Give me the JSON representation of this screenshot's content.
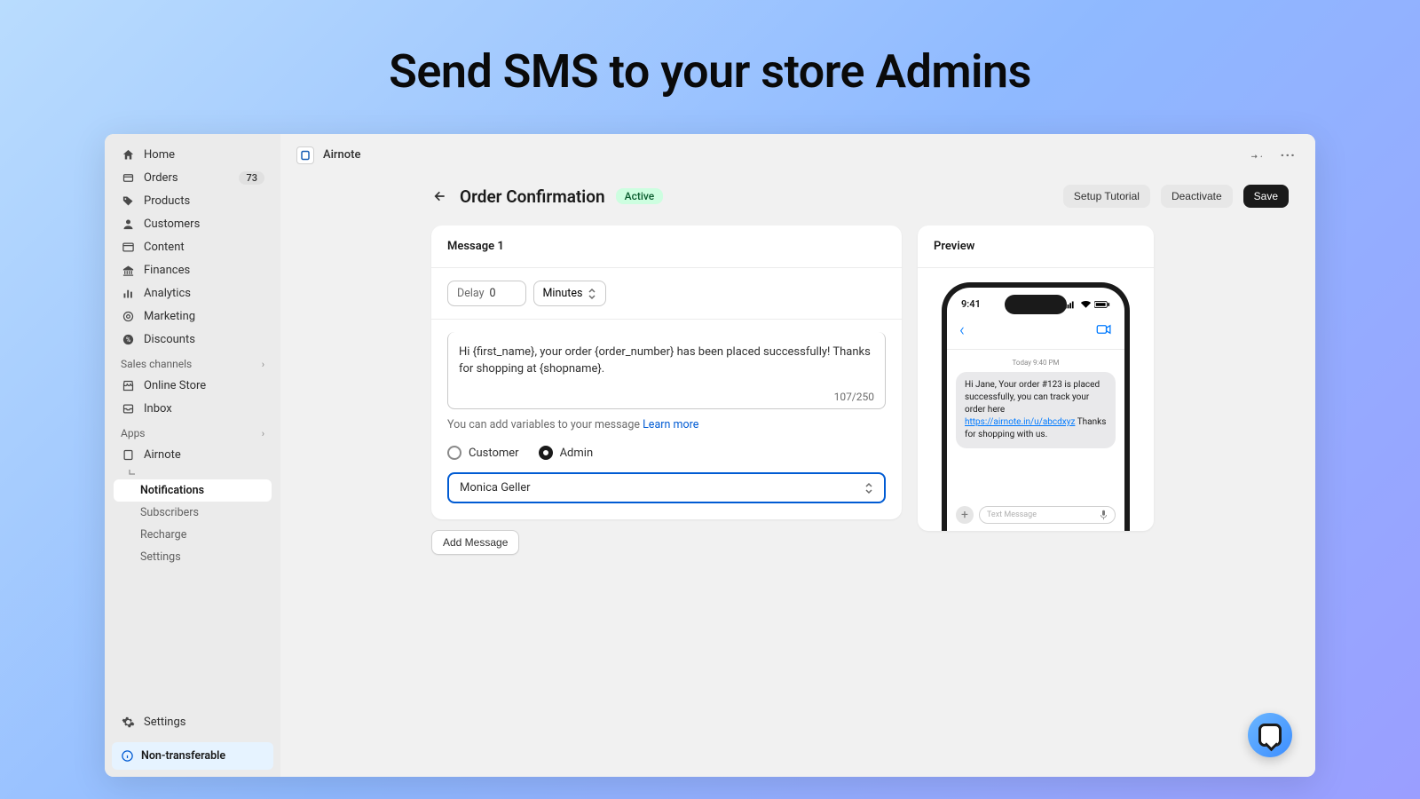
{
  "hero": {
    "title": "Send SMS to your store Admins"
  },
  "sidebar": {
    "nav": [
      {
        "label": "Home",
        "icon": "home"
      },
      {
        "label": "Orders",
        "icon": "orders",
        "badge": "73"
      },
      {
        "label": "Products",
        "icon": "tag"
      },
      {
        "label": "Customers",
        "icon": "user"
      },
      {
        "label": "Content",
        "icon": "content"
      },
      {
        "label": "Finances",
        "icon": "bank"
      },
      {
        "label": "Analytics",
        "icon": "bars"
      },
      {
        "label": "Marketing",
        "icon": "target"
      },
      {
        "label": "Discounts",
        "icon": "discount"
      }
    ],
    "sections": {
      "sales_channels": {
        "title": "Sales channels",
        "items": [
          {
            "label": "Online Store",
            "icon": "store"
          },
          {
            "label": "Inbox",
            "icon": "inbox"
          }
        ]
      },
      "apps": {
        "title": "Apps",
        "items": [
          {
            "label": "Airnote",
            "icon": "airnote",
            "children": [
              {
                "label": "Notifications",
                "active": true
              },
              {
                "label": "Subscribers"
              },
              {
                "label": "Recharge"
              },
              {
                "label": "Settings"
              }
            ]
          }
        ]
      }
    },
    "settings_label": "Settings",
    "nt_label": "Non-transferable"
  },
  "topbar": {
    "app_name": "Airnote"
  },
  "page": {
    "title": "Order Confirmation",
    "status": "Active",
    "buttons": {
      "tutorial": "Setup Tutorial",
      "deactivate": "Deactivate",
      "save": "Save"
    }
  },
  "message": {
    "header": "Message 1",
    "delay": {
      "label": "Delay",
      "value": "0",
      "unit": "Minutes"
    },
    "body": "Hi {first_name}, your order {order_number} has been placed successfully! Thanks for shopping at {shopname}.",
    "count": "107/250",
    "help_text": "You can add variables to your message ",
    "help_link": "Learn more",
    "recipient": {
      "customer": "Customer",
      "admin": "Admin",
      "selected": "admin"
    },
    "admin_select": "Monica Geller",
    "add_label": "Add Message"
  },
  "preview": {
    "header": "Preview",
    "phone": {
      "time": "9:41",
      "timestamp": "Today 9:40 PM",
      "bubble_prefix": "Hi Jane, Your order #123 is placed successfully, you can track your order here ",
      "bubble_link": "https://airnote.in/u/abcdxyz",
      "bubble_suffix": " Thanks for shopping with us.",
      "input_placeholder": "Text Message"
    }
  }
}
